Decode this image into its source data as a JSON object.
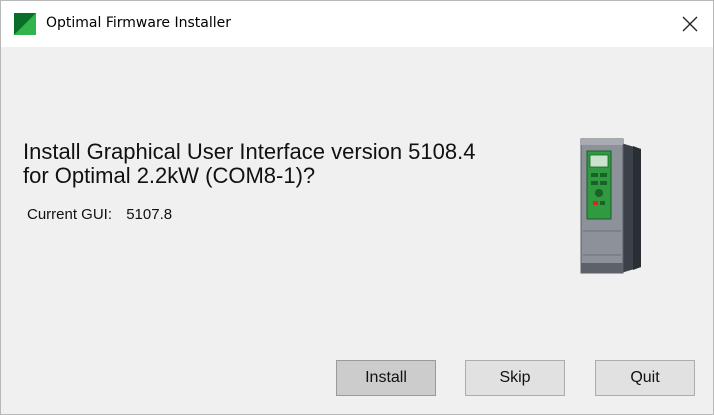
{
  "window": {
    "title": "Optimal Firmware Installer",
    "app_icon": "optimal-app-icon",
    "close_icon": "close-icon"
  },
  "prompt": {
    "line1": "Install Graphical User Interface version 5108.4",
    "line2": "for Optimal 2.2kW (COM8-1)?",
    "current_label": "Current GUI:",
    "current_value": "5107.8"
  },
  "device_image": "drive-unit-image",
  "buttons": {
    "install": "Install",
    "skip": "Skip",
    "quit": "Quit"
  },
  "colors": {
    "icon_green": "#1d9a3b",
    "window_bg": "#f0f0f0",
    "titlebar_bg": "#ffffff",
    "default_button_bg": "#cccccc",
    "button_bg": "#e1e1e1"
  }
}
